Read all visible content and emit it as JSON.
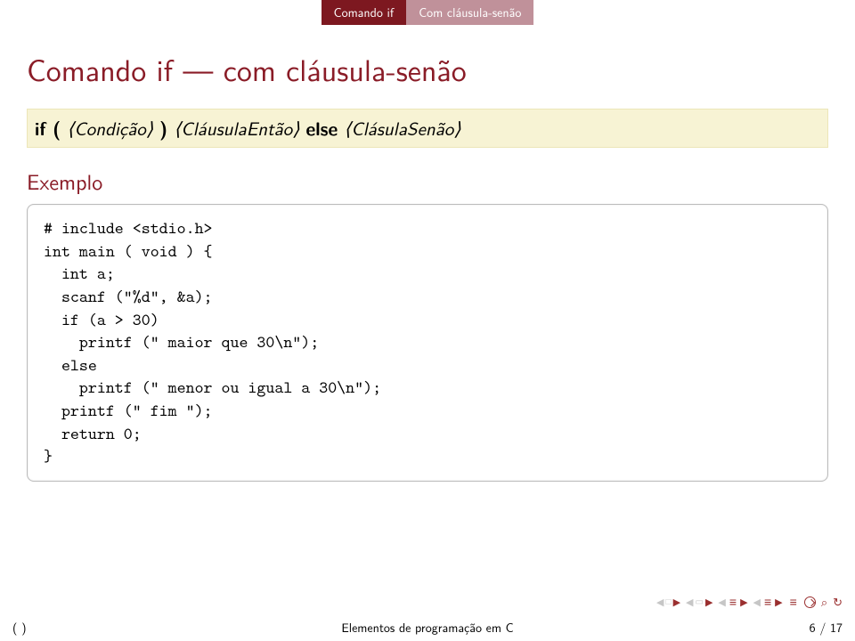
{
  "header": {
    "left": "Comando if",
    "right": "Com cláusula-senão"
  },
  "title": "Comando if — com cláusula-senão",
  "syntax": {
    "kw_if": "if (",
    "cond": "Condição",
    "kw_close": ")",
    "then": "CláusulaEntão",
    "kw_else": "else",
    "else": "ClásulaSenão"
  },
  "example_label": "Exemplo",
  "code": "# include <stdio.h>\nint main ( void ) {\n  int a;\n  scanf (\"%d\", &a);\n  if (a > 30)\n    printf (\" maior que 30\\n\");\n  else\n    printf (\" menor ou igual a 30\\n\");\n  printf (\" fim \");\n  return 0;\n}",
  "footer": {
    "left": "( )",
    "center": "Elementos de programação em C",
    "right": "6 / 17"
  }
}
